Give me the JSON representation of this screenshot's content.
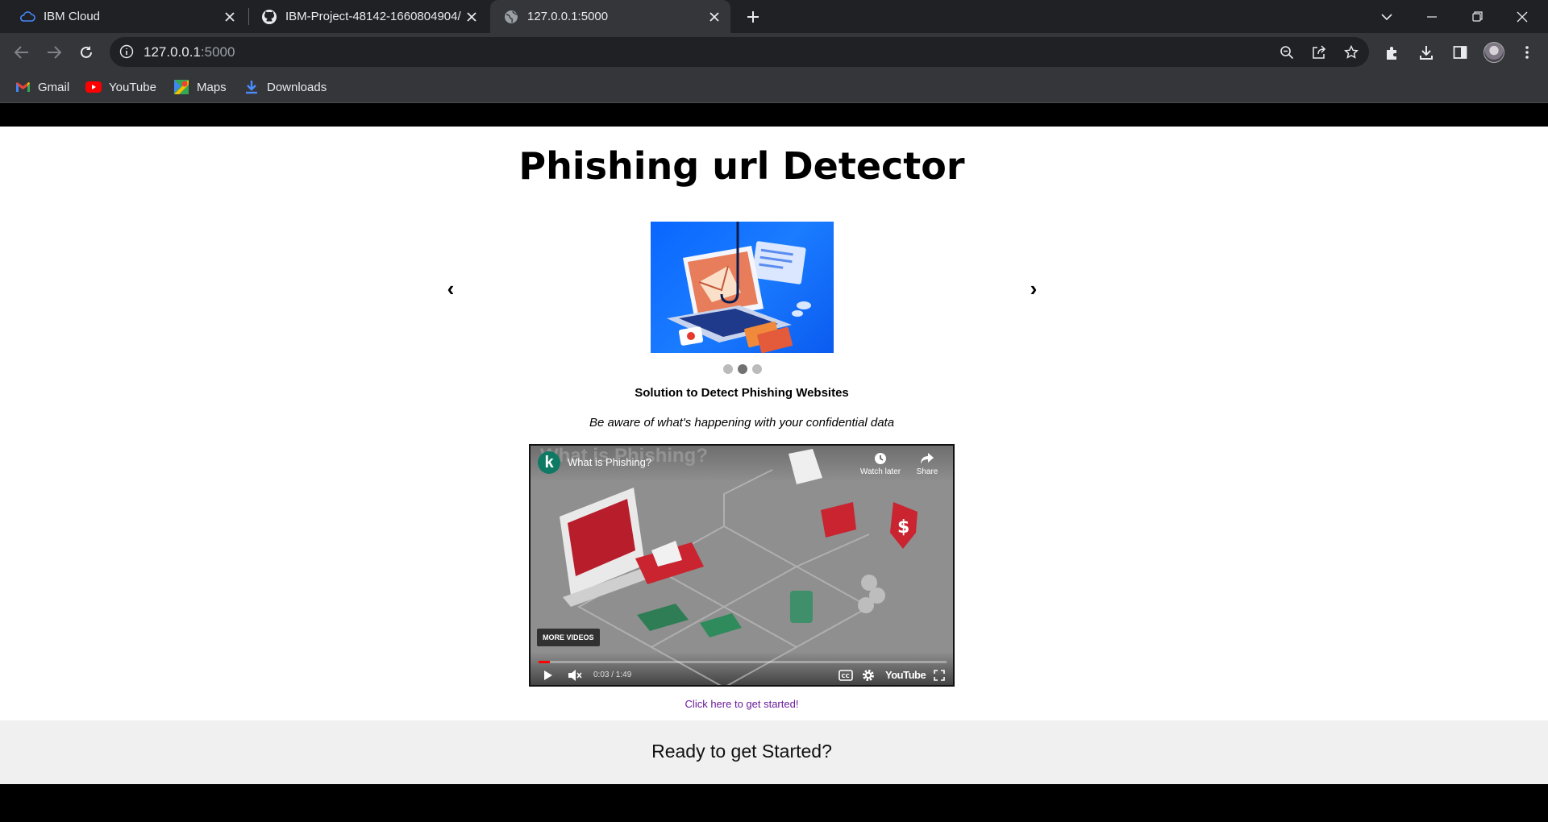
{
  "browser": {
    "tabs": [
      {
        "title": "IBM Cloud",
        "icon": "ibm-cloud-icon"
      },
      {
        "title": "IBM-Project-48142-1660804904/",
        "icon": "github-icon"
      },
      {
        "title": "127.0.0.1:5000",
        "icon": "globe-icon",
        "active": true
      }
    ],
    "url_host": "127.0.0.1",
    "url_port": ":5000",
    "bookmarks": [
      {
        "label": "Gmail",
        "icon": "gmail-icon"
      },
      {
        "label": "YouTube",
        "icon": "youtube-icon"
      },
      {
        "label": "Maps",
        "icon": "maps-icon"
      },
      {
        "label": "Downloads",
        "icon": "download-icon"
      }
    ]
  },
  "page": {
    "title": "Phishing url Detector",
    "carousel": {
      "prev": "‹",
      "next": "›",
      "slide_count": 3,
      "active_slide": 2,
      "caption": "Solution to Detect Phishing Websites",
      "subtitle": "Be aware of what's happening with your confidential data"
    },
    "video": {
      "channel_letter": "k",
      "title": "What is Phishing?",
      "watch_later": "Watch later",
      "share": "Share",
      "more_videos": "MORE VIDEOS",
      "time": "0:03 / 1:49",
      "brand": "YouTube"
    },
    "cta_link": "Click here to get started!",
    "footer_text": "Ready to get Started?"
  }
}
